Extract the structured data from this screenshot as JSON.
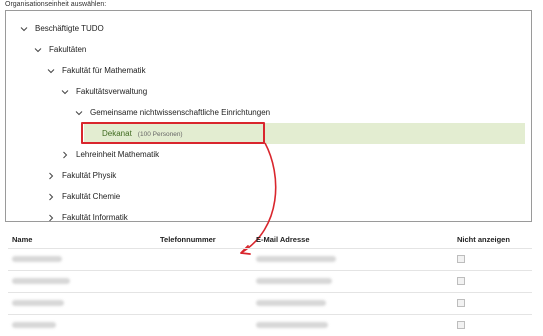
{
  "header": {
    "label": "Organisationseinheit auswählen:"
  },
  "tree": {
    "nodes": [
      {
        "label": "Beschäftigte TUDO",
        "chevron": "expanded"
      },
      {
        "label": "Fakultäten",
        "chevron": "expanded"
      },
      {
        "label": "Fakultät für Mathematik",
        "chevron": "expanded"
      },
      {
        "label": "Fakultätsverwaltung",
        "chevron": "expanded"
      },
      {
        "label": "Gemeinsame nichtwissenschaftliche Einrichtungen",
        "chevron": "expanded"
      },
      {
        "label": "Lehreinheit Mathematik",
        "chevron": "collapsed"
      },
      {
        "label": "Fakultät Physik",
        "chevron": "collapsed"
      },
      {
        "label": "Fakultät Chemie",
        "chevron": "collapsed"
      },
      {
        "label": "Fakultät Informatik",
        "chevron": "collapsed"
      }
    ],
    "selected": {
      "label": "Dekanat",
      "count": "(100 Personen)"
    }
  },
  "table": {
    "columns": [
      "Name",
      "Telefonnummer",
      "E-Mail Adresse",
      "Nicht anzeigen"
    ]
  },
  "colors": {
    "highlight_bg": "#e3edd1",
    "highlight_text": "#3f6a1f",
    "annotation_red": "#d9262d"
  }
}
